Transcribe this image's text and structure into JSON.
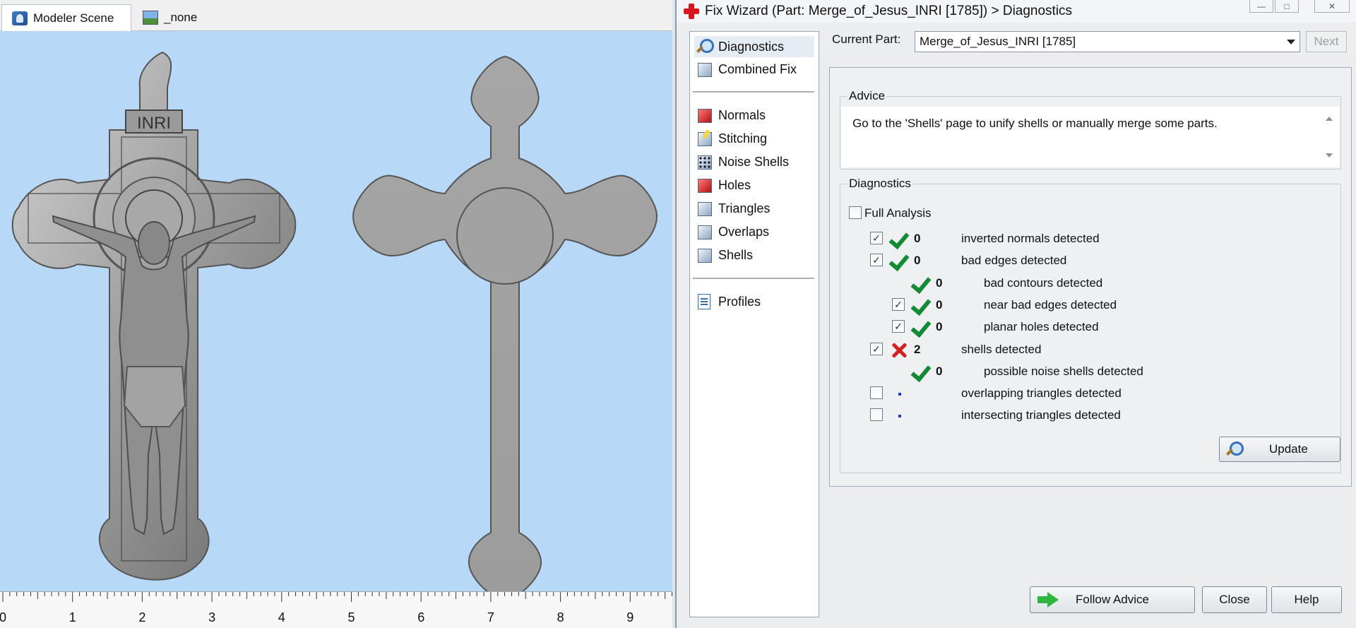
{
  "scene": {
    "tabs": [
      {
        "label": "Modeler Scene",
        "icon": "modeler-scene-icon",
        "active": true
      },
      {
        "label": "_none",
        "icon": "landscape-icon",
        "active": false
      }
    ],
    "viewport_bg": "#b7d8f6",
    "ruler_labels": [
      "0",
      "1",
      "2",
      "3",
      "4",
      "5",
      "6",
      "7",
      "8",
      "9"
    ],
    "inri_text": "INRI"
  },
  "wizard": {
    "title": "Fix Wizard (Part: Merge_of_Jesus_INRI [1785]) > Diagnostics",
    "window_buttons": {
      "minimize": "—",
      "maximize": "□",
      "close": "✕"
    },
    "nav": {
      "items": [
        {
          "label": "Diagnostics",
          "icon": "magnifier-icon",
          "selected": true
        },
        {
          "label": "Combined Fix",
          "icon": "stacked-cubes-icon"
        },
        {
          "label": "Normals",
          "icon": "red-cube-icon"
        },
        {
          "label": "Stitching",
          "icon": "stitch-cube-icon"
        },
        {
          "label": "Noise Shells",
          "icon": "dotted-cube-icon"
        },
        {
          "label": "Holes",
          "icon": "hole-cube-icon"
        },
        {
          "label": "Triangles",
          "icon": "triangle-cube-icon"
        },
        {
          "label": "Overlaps",
          "icon": "overlap-cube-icon"
        },
        {
          "label": "Shells",
          "icon": "shells-cube-icon"
        },
        {
          "label": "Profiles",
          "icon": "document-icon"
        }
      ]
    },
    "current_part": {
      "label": "Current Part:",
      "value": "Merge_of_Jesus_INRI [1785]"
    },
    "next_label": "Next",
    "advice": {
      "title": "Advice",
      "text": "Go to the 'Shells' page to unify shells or manually merge some parts."
    },
    "diagnostics": {
      "title": "Diagnostics",
      "full_analysis_label": "Full Analysis",
      "full_analysis_checked": false,
      "rows": [
        {
          "checkbox": true,
          "checked": true,
          "status": "ok",
          "count": "0",
          "label": "inverted normals detected",
          "indent": 0
        },
        {
          "checkbox": true,
          "checked": true,
          "status": "ok",
          "count": "0",
          "label": "bad edges detected",
          "indent": 0
        },
        {
          "checkbox": false,
          "checked": false,
          "status": "ok",
          "count": "0",
          "label": "bad contours detected",
          "indent": 1
        },
        {
          "checkbox": true,
          "checked": true,
          "status": "ok",
          "count": "0",
          "label": "near bad edges detected",
          "indent": 1
        },
        {
          "checkbox": true,
          "checked": true,
          "status": "ok",
          "count": "0",
          "label": "planar holes detected",
          "indent": 1
        },
        {
          "checkbox": true,
          "checked": true,
          "status": "error",
          "count": "2",
          "label": "shells detected",
          "indent": 0
        },
        {
          "checkbox": false,
          "checked": false,
          "status": "ok",
          "count": "0",
          "label": "possible noise shells detected",
          "indent": 1
        },
        {
          "checkbox": true,
          "checked": false,
          "status": "none",
          "count": "",
          "label": "overlapping triangles detected",
          "indent": 0
        },
        {
          "checkbox": true,
          "checked": false,
          "status": "none",
          "count": "",
          "label": "intersecting triangles detected",
          "indent": 0
        }
      ],
      "update_label": "Update"
    },
    "buttons": {
      "follow_advice": "Follow Advice",
      "close": "Close",
      "help": "Help"
    },
    "colors": {
      "ok": "#138a34",
      "error": "#d31f1f",
      "accent": "#d6161c"
    }
  }
}
